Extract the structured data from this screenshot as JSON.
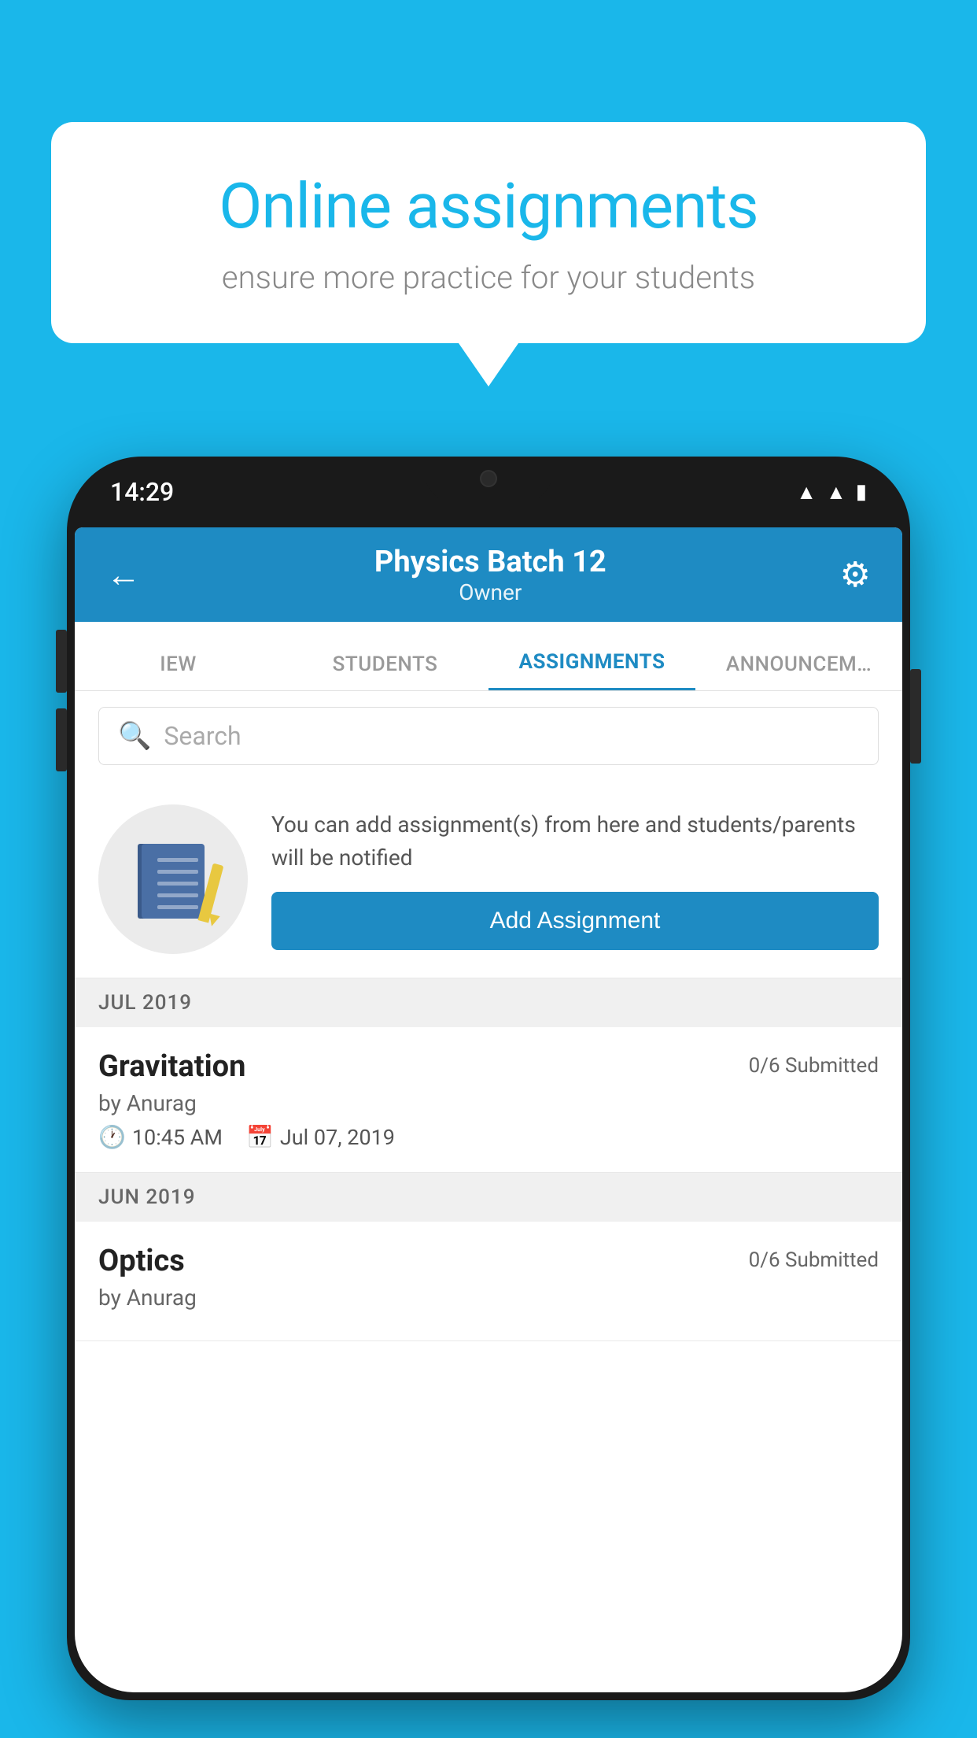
{
  "background": {
    "color": "#1ab7ea"
  },
  "speech_bubble": {
    "title": "Online assignments",
    "subtitle": "ensure more practice for your students"
  },
  "phone": {
    "status_bar": {
      "time": "14:29",
      "icons": [
        "wifi",
        "signal",
        "battery"
      ]
    },
    "header": {
      "title": "Physics Batch 12",
      "subtitle": "Owner",
      "back_label": "←",
      "settings_label": "⚙"
    },
    "tabs": [
      {
        "label": "IEW",
        "active": false
      },
      {
        "label": "STUDENTS",
        "active": false
      },
      {
        "label": "ASSIGNMENTS",
        "active": true
      },
      {
        "label": "ANNOUNCEM…",
        "active": false
      }
    ],
    "search": {
      "placeholder": "Search"
    },
    "promo": {
      "text": "You can add assignment(s) from here and students/parents will be notified",
      "button_label": "Add Assignment"
    },
    "assignments": [
      {
        "month": "JUL 2019",
        "items": [
          {
            "title": "Gravitation",
            "submitted": "0/6 Submitted",
            "by": "by Anurag",
            "time": "10:45 AM",
            "date": "Jul 07, 2019"
          }
        ]
      },
      {
        "month": "JUN 2019",
        "items": [
          {
            "title": "Optics",
            "submitted": "0/6 Submitted",
            "by": "by Anurag",
            "time": "",
            "date": ""
          }
        ]
      }
    ]
  }
}
